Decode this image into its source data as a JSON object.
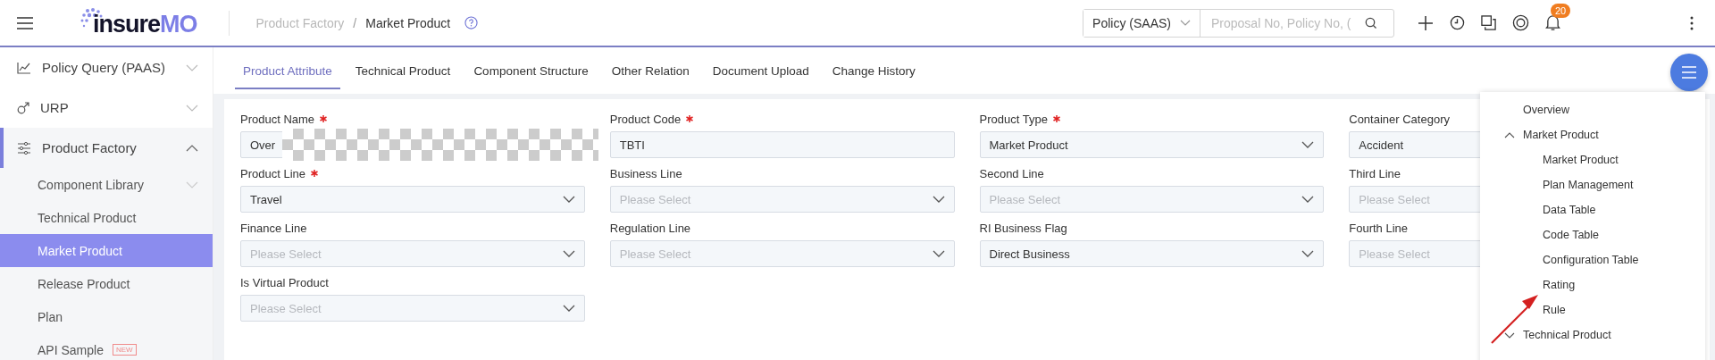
{
  "header": {
    "logo": "insureMO",
    "breadcrumb_separator": "/",
    "breadcrumb": [
      {
        "label": "Product Factory",
        "current": false
      },
      {
        "label": "Market Product",
        "current": true
      }
    ],
    "scope_select": {
      "value": "Policy (SAAS)"
    },
    "search": {
      "placeholder": "Proposal No, Policy No, ("
    },
    "notification_count": "20"
  },
  "sidebar": {
    "items": [
      {
        "label": "Policy Query (PAAS)",
        "selected": false,
        "expanded": false
      },
      {
        "label": "URP",
        "selected": false,
        "expanded": false
      },
      {
        "label": "Product Factory",
        "selected": false,
        "expanded": true,
        "children": [
          {
            "label": "Component Library",
            "selected": false,
            "expanded": false
          },
          {
            "label": "Technical Product",
            "selected": false
          },
          {
            "label": "Market Product",
            "selected": true
          },
          {
            "label": "Release Product",
            "selected": false
          },
          {
            "label": "Plan",
            "selected": false
          },
          {
            "label": "API Sample",
            "selected": false,
            "badge": "NEW"
          }
        ]
      }
    ]
  },
  "tabs": [
    {
      "label": "Product Attribute",
      "selected": true
    },
    {
      "label": "Technical Product",
      "selected": false
    },
    {
      "label": "Component Structure",
      "selected": false
    },
    {
      "label": "Other Relation",
      "selected": false
    },
    {
      "label": "Document Upload",
      "selected": false
    },
    {
      "label": "Change History",
      "selected": false
    }
  ],
  "form": {
    "fields": [
      {
        "label": "Product Name",
        "required": true,
        "kind": "input",
        "value": "Over",
        "redacted": true
      },
      {
        "label": "Product Code",
        "required": true,
        "kind": "input",
        "value": "TBTI"
      },
      {
        "label": "Product Type",
        "required": true,
        "kind": "select",
        "value": "Market Product"
      },
      {
        "label": "Container Category",
        "required": false,
        "kind": "select",
        "value": "Accident"
      },
      {
        "label": "Product Line",
        "required": true,
        "kind": "select",
        "value": "Travel"
      },
      {
        "label": "Business Line",
        "required": false,
        "kind": "select",
        "placeholder": "Please Select"
      },
      {
        "label": "Second Line",
        "required": false,
        "kind": "select",
        "placeholder": "Please Select"
      },
      {
        "label": "Third Line",
        "required": false,
        "kind": "select",
        "placeholder": "Please Select"
      },
      {
        "label": "Finance Line",
        "required": false,
        "kind": "select",
        "placeholder": "Please Select"
      },
      {
        "label": "Regulation Line",
        "required": false,
        "kind": "select",
        "placeholder": "Please Select"
      },
      {
        "label": "RI Business Flag",
        "required": false,
        "kind": "select",
        "value": "Direct Business"
      },
      {
        "label": "Fourth Line",
        "required": false,
        "kind": "select",
        "placeholder": "Please Select"
      },
      {
        "label": "Is Virtual Product",
        "required": false,
        "kind": "select",
        "placeholder": "Please Select"
      }
    ]
  },
  "outline_menu": {
    "items": [
      {
        "label": "Overview"
      },
      {
        "label": "Market Product",
        "expanded": true,
        "children": [
          {
            "label": "Market Product"
          },
          {
            "label": "Plan Management"
          },
          {
            "label": "Data Table"
          },
          {
            "label": "Code Table"
          },
          {
            "label": "Configuration Table"
          },
          {
            "label": "Rating"
          },
          {
            "label": "Rule"
          }
        ]
      },
      {
        "label": "Technical Product",
        "expanded": false
      }
    ]
  }
}
